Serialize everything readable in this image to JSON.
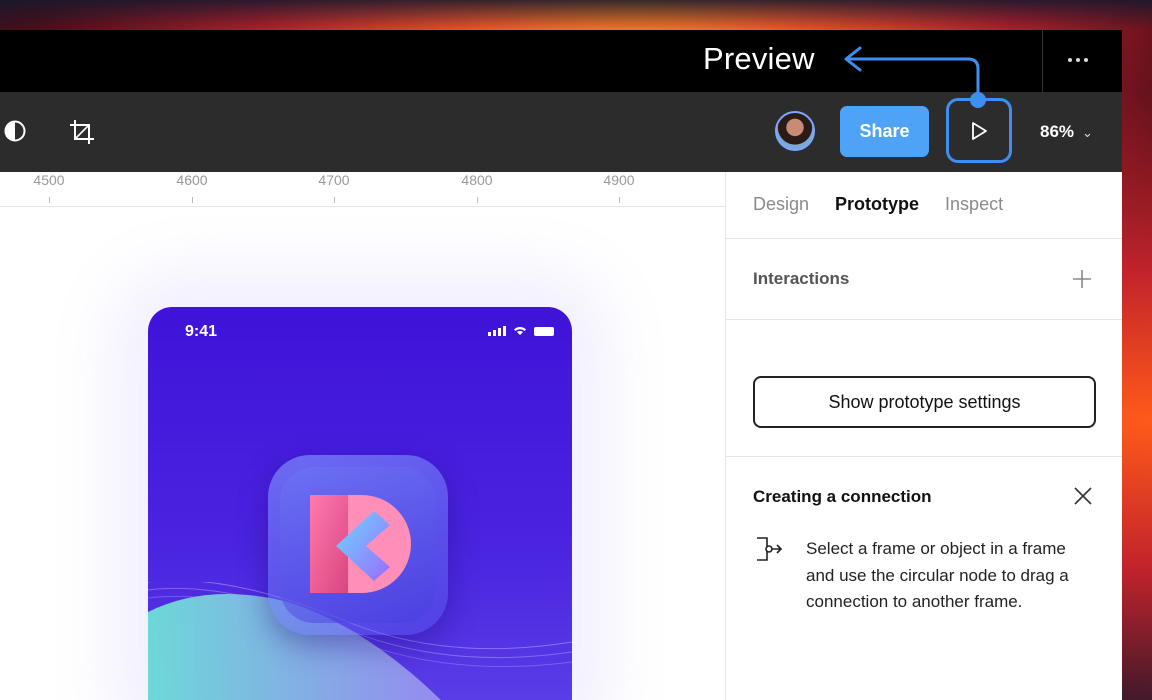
{
  "titlebar": {
    "preview_label": "Preview",
    "more_icon": "more-horizontal-icon"
  },
  "toolbar": {
    "left_icons": [
      "contrast-icon",
      "crop-icon"
    ],
    "share_label": "Share",
    "play_icon": "play-icon",
    "zoom_level": "86%"
  },
  "canvas": {
    "ruler_ticks": [
      "4500",
      "4600",
      "4700",
      "4800",
      "4900"
    ],
    "phone": {
      "time": "9:41"
    }
  },
  "panel": {
    "tabs": [
      {
        "label": "Design",
        "active": false
      },
      {
        "label": "Prototype",
        "active": true
      },
      {
        "label": "Inspect",
        "active": false
      }
    ],
    "interactions_title": "Interactions",
    "prototype_settings_label": "Show prototype settings",
    "connection_title": "Creating a connection",
    "connection_text": "Select a frame or object in a frame and use the circular node to drag a connection to another frame."
  },
  "colors": {
    "accent": "#4fa3f7",
    "callout": "#3d8ff0",
    "phone_bg": "#3f13d8"
  }
}
